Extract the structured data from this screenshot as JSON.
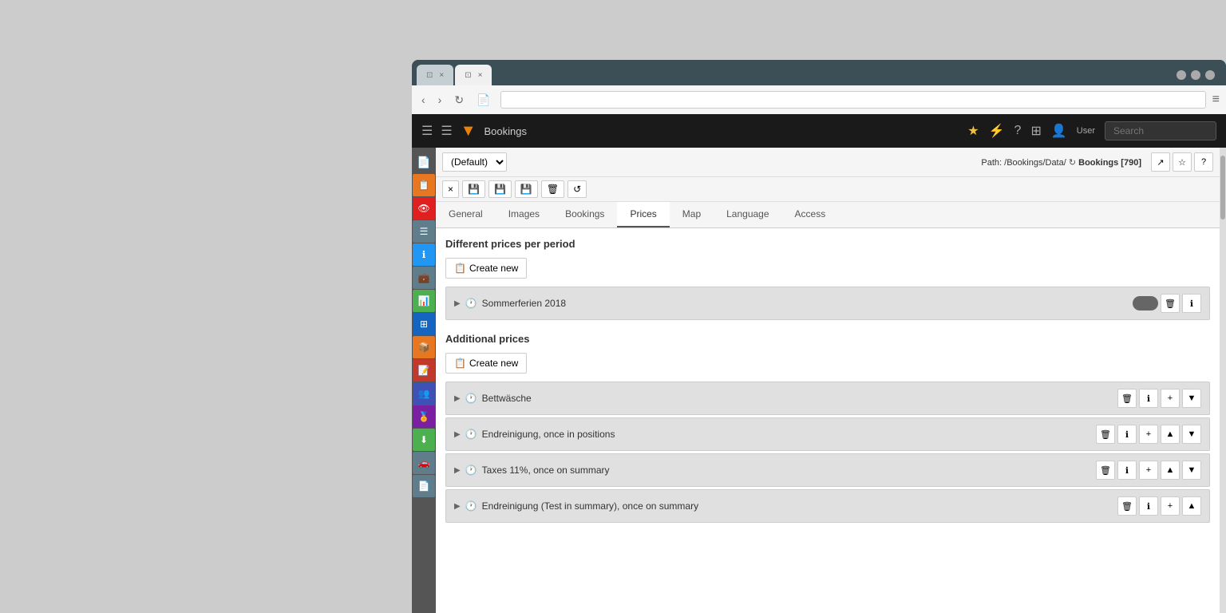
{
  "browser": {
    "tabs": [
      {
        "label": "",
        "active": false,
        "close": "×"
      },
      {
        "label": "",
        "active": true,
        "close": "×"
      }
    ],
    "window_controls": [
      "gray",
      "gray",
      "gray"
    ],
    "nav": {
      "back": "‹",
      "forward": "›",
      "reload": "↻",
      "page": "📄"
    },
    "menu_icon": "≡"
  },
  "app_header": {
    "menu_icon": "☰",
    "list_icon": "☰",
    "logo": "▼",
    "app_name": "Bookings",
    "star_icon": "★",
    "bolt_icon": "⚡",
    "help_icon": "?",
    "grid_icon": "⊞",
    "user_icon": "👤",
    "search_placeholder": "Search"
  },
  "toolbar": {
    "select_default": "(Default)",
    "path_label": "Path: /Bookings/Data/",
    "bookings_label": "Bookings [790]",
    "close_btn": "×",
    "save_btn": "💾",
    "save2_btn": "💾",
    "save3_btn": "💾",
    "delete_btn": "🗑",
    "refresh_btn": "↺",
    "external_btn": "↗",
    "star_btn": "☆",
    "help_btn": "?"
  },
  "tabs": [
    {
      "label": "General",
      "active": false
    },
    {
      "label": "Images",
      "active": false
    },
    {
      "label": "Bookings",
      "active": false
    },
    {
      "label": "Prices",
      "active": true
    },
    {
      "label": "Map",
      "active": false
    },
    {
      "label": "Language",
      "active": false
    },
    {
      "label": "Access",
      "active": false
    }
  ],
  "prices_section": {
    "title": "Different prices per period",
    "create_new_label": "Create new",
    "items": [
      {
        "name": "Sommerferien 2018",
        "has_toggle": true,
        "has_delete": true,
        "has_info": true
      }
    ]
  },
  "additional_prices_section": {
    "title": "Additional prices",
    "create_new_label": "Create new",
    "items": [
      {
        "name": "Bettwäsche",
        "has_delete": true,
        "has_info": true,
        "has_add": true,
        "has_down": true,
        "has_up": false
      },
      {
        "name": "Endreinigung, once in positions",
        "has_delete": true,
        "has_info": true,
        "has_add": true,
        "has_up": true,
        "has_down": true
      },
      {
        "name": "Taxes 11%, once on summary",
        "has_delete": true,
        "has_info": true,
        "has_add": true,
        "has_up": true,
        "has_down": true
      },
      {
        "name": "Endreinigung (Test in summary), once on summary",
        "has_delete": true,
        "has_info": true,
        "has_add": true,
        "has_up": true,
        "has_down": false
      }
    ]
  },
  "sidebar": {
    "items": [
      {
        "icon": "📄",
        "color": "#888"
      },
      {
        "icon": "📋",
        "color": "#e87722"
      },
      {
        "icon": "👁",
        "color": "#e02020"
      },
      {
        "icon": "☰",
        "color": "#607d8b"
      },
      {
        "icon": "ℹ",
        "color": "#2196f3"
      },
      {
        "icon": "💼",
        "color": "#607d8b"
      },
      {
        "icon": "📊",
        "color": "#4caf50"
      },
      {
        "icon": "⊞",
        "color": "#1565c0"
      },
      {
        "icon": "📦",
        "color": "#e87722"
      },
      {
        "icon": "📝",
        "color": "#c0392b"
      },
      {
        "icon": "👥",
        "color": "#3f51b5"
      },
      {
        "icon": "🏅",
        "color": "#7b1fa2"
      },
      {
        "icon": "⬇",
        "color": "#4caf50"
      },
      {
        "icon": "🚗",
        "color": "#607d8b"
      },
      {
        "icon": "📄",
        "color": "#607d8b"
      }
    ]
  }
}
